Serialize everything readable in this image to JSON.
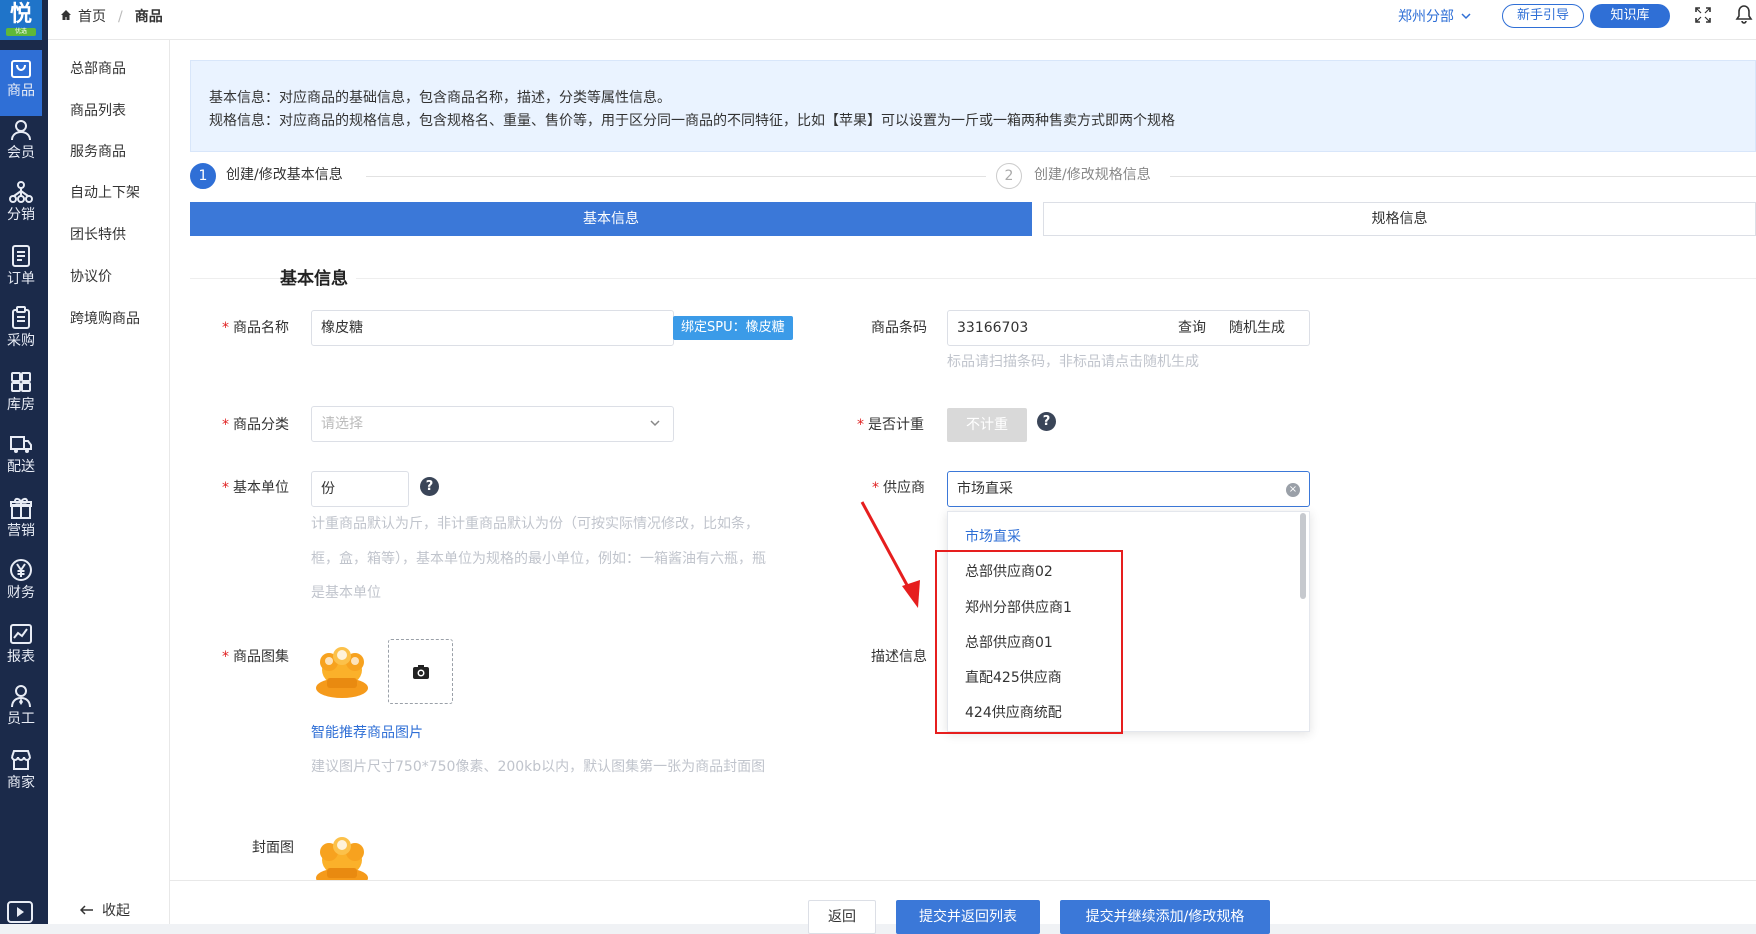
{
  "app": {
    "logo_char": "悦",
    "logo_sub": "优选",
    "accent": "#2f6fd6"
  },
  "rail": [
    {
      "label": "商品",
      "icon": "bag-icon",
      "active": true
    },
    {
      "label": "会员",
      "icon": "user-icon"
    },
    {
      "label": "分销",
      "icon": "network-icon"
    },
    {
      "label": "订单",
      "icon": "order-icon"
    },
    {
      "label": "采购",
      "icon": "clipboard-icon"
    },
    {
      "label": "库房",
      "icon": "warehouse-icon"
    },
    {
      "label": "配送",
      "icon": "truck-icon"
    },
    {
      "label": "营销",
      "icon": "gift-icon"
    },
    {
      "label": "财务",
      "icon": "yen-icon"
    },
    {
      "label": "报表",
      "icon": "chart-icon"
    },
    {
      "label": "员工",
      "icon": "staff-icon"
    },
    {
      "label": "商家",
      "icon": "store-icon"
    }
  ],
  "header": {
    "breadcrumb_home": "首页",
    "breadcrumb_current": "商品",
    "branch": "郑州分部",
    "guide_label": "新手引导",
    "kb_label": "知识库"
  },
  "submenu": {
    "items": [
      "总部商品",
      "商品列表",
      "服务商品",
      "自动上下架",
      "团长特供",
      "协议价",
      "跨境购商品"
    ],
    "collapse_label": "收起"
  },
  "tip": {
    "line1": "基本信息：对应商品的基础信息，包含商品名称，描述，分类等属性信息。",
    "line2": "规格信息：对应商品的规格信息，包含规格名、重量、售价等，用于区分同一商品的不同特征，比如【苹果】可以设置为一斤或一箱两种售卖方式即两个规格"
  },
  "steps": {
    "step1_num": "1",
    "step1_label": "创建/修改基本信息",
    "step2_num": "2",
    "step2_label": "创建/修改规格信息"
  },
  "tabs": {
    "basic": "基本信息",
    "spec": "规格信息"
  },
  "section_title": "基本信息",
  "form": {
    "name_label": "商品名称",
    "name_value": "橡皮糖",
    "spu_tag": "绑定SPU：橡皮糖",
    "barcode_label": "商品条码",
    "barcode_value": "33166703",
    "barcode_query": "查询",
    "barcode_random": "随机生成",
    "barcode_hint": "标品请扫描条码，非标品请点击随机生成",
    "category_label": "商品分类",
    "category_placeholder": "请选择",
    "weigh_label": "是否计重",
    "weigh_value": "不计重",
    "unit_label": "基本单位",
    "unit_value": "份",
    "unit_hint_1": "计重商品默认为斤，非计重商品默认为份（可按实际情况修改，比如条，",
    "unit_hint_2": "框，盒，箱等），基本单位为规格的最小单位，例如：一箱酱油有六瓶，瓶",
    "unit_hint_3": "是基本单位",
    "supplier_label": "供应商",
    "supplier_value": "市场直采",
    "supplier_options": [
      "市场直采",
      "总部供应商02",
      "郑州分部供应商1",
      "总部供应商01",
      "直配425供应商",
      "424供应商统配"
    ],
    "gallery_label": "商品图集",
    "desc_label": "描述信息",
    "smart_link": "智能推荐商品图片",
    "image_hint": "建议图片尺寸750*750像素、200kb以内，默认图集第一张为商品封面图",
    "cover_label": "封面图"
  },
  "footer": {
    "back": "返回",
    "submit_list": "提交并返回列表",
    "submit_spec": "提交并继续添加/修改规格"
  }
}
